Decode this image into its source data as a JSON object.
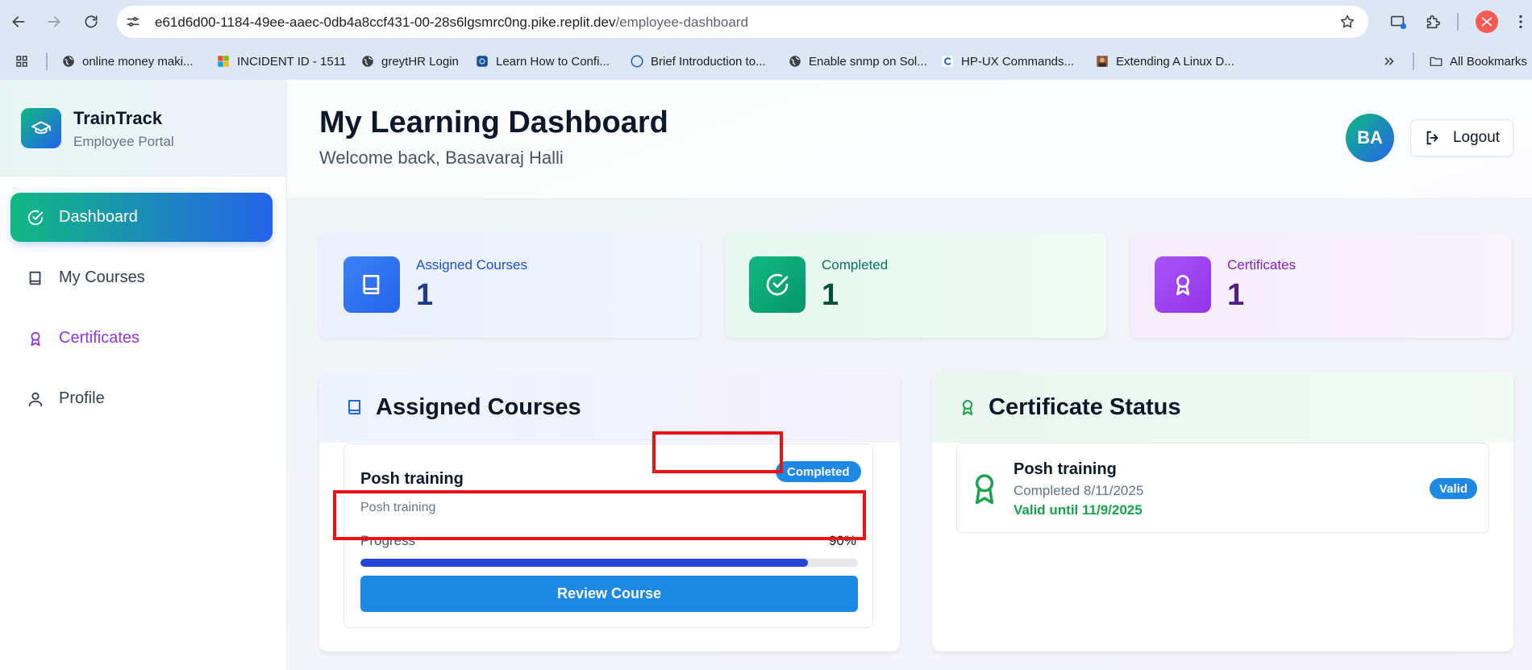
{
  "browser": {
    "url_host": "e61d6d00-1184-49ee-aaec-0db4a8ccf431-00-28s6lgsmrc0ng.pike.replit.dev",
    "url_path": "/employee-dashboard",
    "bookmarks": [
      {
        "label": "online money maki...",
        "icon": "globe-icon"
      },
      {
        "label": "INCIDENT ID - 1511",
        "icon": "windows-logo-icon"
      },
      {
        "label": "greytHR Login",
        "icon": "globe-icon"
      },
      {
        "label": "Learn How to Confi...",
        "icon": "site-favicon-icon"
      },
      {
        "label": "Brief Introduction to...",
        "icon": "circle-icon"
      },
      {
        "label": "Enable snmp on Sol...",
        "icon": "globe-icon"
      },
      {
        "label": "HP-UX Commands...",
        "icon": "c-favicon-icon"
      },
      {
        "label": "Extending A Linux D...",
        "icon": "photo-favicon-icon"
      }
    ],
    "all_bookmarks_label": "All Bookmarks",
    "colors": {
      "chrome_bg": "#dde6f4",
      "profile": "#f25c54"
    }
  },
  "sidebar": {
    "brand_name": "TrainTrack",
    "brand_subtitle": "Employee Portal",
    "items": [
      {
        "label": "Dashboard",
        "icon": "check-circle-icon",
        "active": true
      },
      {
        "label": "My Courses",
        "icon": "book-icon",
        "active": false
      },
      {
        "label": "Certificates",
        "icon": "award-icon",
        "active": false
      },
      {
        "label": "Profile",
        "icon": "user-icon",
        "active": false
      }
    ]
  },
  "header": {
    "title": "My Learning Dashboard",
    "welcome": "Welcome back, Basavaraj Halli",
    "avatar_initials": "BA",
    "logout_label": "Logout"
  },
  "stats": [
    {
      "label": "Assigned Courses",
      "value": "1",
      "icon": "book-icon"
    },
    {
      "label": "Completed",
      "value": "1",
      "icon": "check-circle-icon"
    },
    {
      "label": "Certificates",
      "value": "1",
      "icon": "award-icon"
    }
  ],
  "assigned_courses": {
    "title": "Assigned Courses",
    "courses": [
      {
        "name": "Posh training",
        "description": "Posh training",
        "status": "Completed",
        "progress_label": "Progress",
        "progress_text": "90%",
        "progress": 0.9,
        "action_label": "Review Course"
      }
    ]
  },
  "certificate_status": {
    "title": "Certificate Status",
    "certificates": [
      {
        "name": "Posh training",
        "completed_text": "Completed 8/11/2025",
        "valid_text": "Valid until 11/9/2025",
        "badge": "Valid"
      }
    ]
  },
  "colors": {
    "accent_gradient_start": "#10b981",
    "accent_gradient_end": "#2563eb",
    "badge_blue": "#1e88e5",
    "highlight_red": "#ee1111",
    "valid_green": "#16a34a"
  }
}
